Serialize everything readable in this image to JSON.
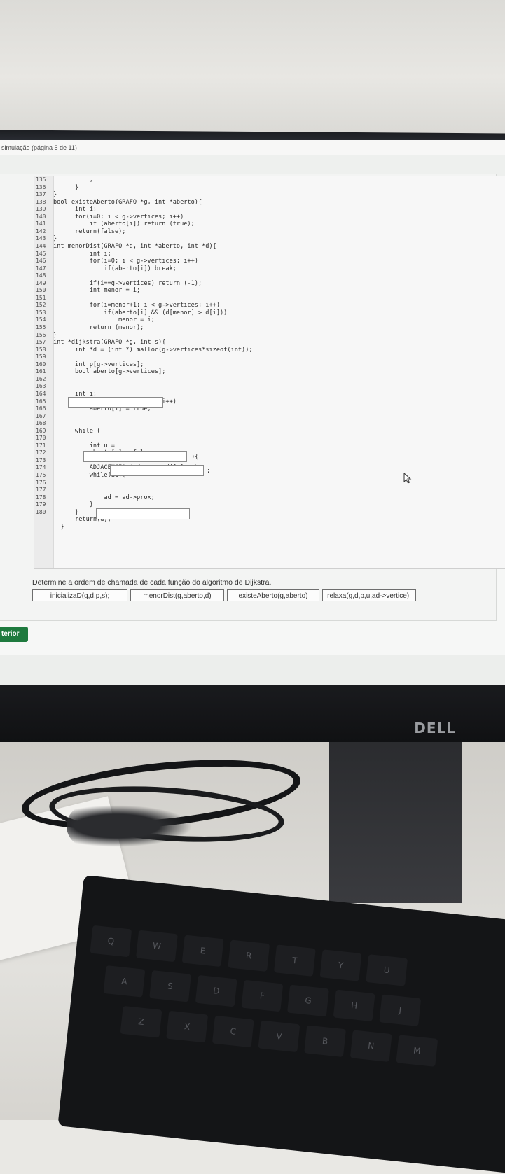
{
  "page": {
    "header_text": "simulação (página 5 de 11)",
    "prompt": "Determine a ordem de chamada de cada função do algoritmo de Dijkstra.",
    "prev_button": "terior",
    "brand": "DELL"
  },
  "code": {
    "lines": [
      {
        "n": "135",
        "text": "          ,"
      },
      {
        "n": "136",
        "text": "      }"
      },
      {
        "n": "137",
        "text": "}"
      },
      {
        "n": "138",
        "text": "bool existeAberto(GRAFO *g, int *aberto){"
      },
      {
        "n": "139",
        "text": "      int i;"
      },
      {
        "n": "140",
        "text": "      for(i=0; i < g->vertices; i++)"
      },
      {
        "n": "141",
        "text": "          if (aberto[i]) return (true);"
      },
      {
        "n": "142",
        "text": "      return(false);"
      },
      {
        "n": "143",
        "text": "}"
      },
      {
        "n": "144",
        "text": "int menorDist(GRAFO *g, int *aberto, int *d){"
      },
      {
        "n": "145",
        "text": "          int i;"
      },
      {
        "n": "146",
        "text": "          for(i=0; i < g->vertices; i++)"
      },
      {
        "n": "147",
        "text": "              if(aberto[i]) break;"
      },
      {
        "n": "148",
        "text": ""
      },
      {
        "n": "149",
        "text": "          if(i==g->vertices) return (-1);"
      },
      {
        "n": "150",
        "text": "          int menor = i;"
      },
      {
        "n": "151",
        "text": ""
      },
      {
        "n": "152",
        "text": "          for(i=menor+1; i < g->vertices; i++)"
      },
      {
        "n": "153",
        "text": "              if(aberto[i] && (d[menor] > d[i]))"
      },
      {
        "n": "154",
        "text": "                  menor = i;"
      },
      {
        "n": "155",
        "text": "          return (menor);"
      },
      {
        "n": "156",
        "text": "}"
      },
      {
        "n": "157",
        "text": "int *dijkstra(GRAFO *g, int s){"
      },
      {
        "n": "158",
        "text": "      int *d = (int *) malloc(g->vertices*sizeof(int));"
      },
      {
        "n": "159",
        "text": ""
      },
      {
        "n": "160",
        "text": "      int p[g->vertices];"
      },
      {
        "n": "161",
        "text": "      bool aberto[g->vertices];"
      },
      {
        "n": "162",
        "text": ""
      },
      {
        "n": "163",
        "text": ""
      },
      {
        "n": "164",
        "text": "      int i;"
      },
      {
        "n": "165",
        "text": "      for(i=0; i<g->vertices; i++)"
      },
      {
        "n": "166",
        "text": "          aberto[i] = true;"
      },
      {
        "n": "167",
        "text": ""
      },
      {
        "n": "168",
        "text": ""
      },
      {
        "n": "169",
        "text": "      while ("
      },
      {
        "n": "170",
        "text": ""
      },
      {
        "n": "171",
        "text": "          int u ="
      },
      {
        "n": "172",
        "text": "          aberto[u] = false;"
      },
      {
        "n": "173",
        "text": ""
      },
      {
        "n": "174",
        "text": "          ADJACENCIA *ad = g->adj[u].cab;"
      },
      {
        "n": "175",
        "text": "          while(ad){"
      },
      {
        "n": "176",
        "text": ""
      },
      {
        "n": "177",
        "text": ""
      },
      {
        "n": "178",
        "text": "              ad = ad->prox;"
      },
      {
        "n": "179",
        "text": "          }"
      },
      {
        "n": "180",
        "text": "      }"
      },
      {
        "n": "",
        "text": "      return(d);"
      },
      {
        "n": "",
        "text": "  }"
      }
    ],
    "while_close": "){",
    "semicolon": ";"
  },
  "drag_items": [
    "inicializaD(g,d,p,s);",
    "menorDist(g,aberto,d)",
    "existeAberto(g,aberto)",
    "relaxa(g,d,p,u,ad->vertice);"
  ],
  "keyboard": {
    "row1": [
      "Q",
      "W",
      "E",
      "R",
      "T",
      "Y",
      "U"
    ],
    "row2": [
      "A",
      "S",
      "D",
      "F",
      "G",
      "H",
      "J"
    ],
    "row3": [
      "Z",
      "X",
      "C",
      "V",
      "B",
      "N",
      "M"
    ]
  }
}
